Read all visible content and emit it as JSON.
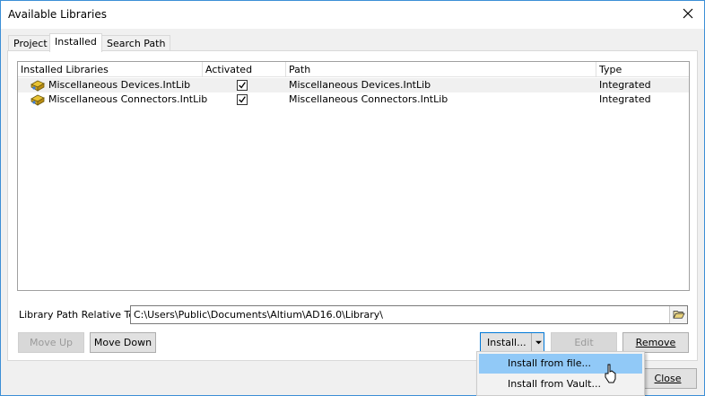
{
  "window": {
    "title": "Available Libraries"
  },
  "tabs": [
    {
      "label": "Project"
    },
    {
      "label": "Installed"
    },
    {
      "label": "Search Path"
    }
  ],
  "grid": {
    "columns": [
      "Installed Libraries",
      "Activated",
      "Path",
      "Type"
    ],
    "rows": [
      {
        "name": "Miscellaneous Devices.IntLib",
        "activated": true,
        "path": "Miscellaneous Devices.IntLib",
        "type": "Integrated"
      },
      {
        "name": "Miscellaneous Connectors.IntLib",
        "activated": true,
        "path": "Miscellaneous Connectors.IntLib",
        "type": "Integrated"
      }
    ]
  },
  "path_field": {
    "label": "Library Path Relative To:",
    "value": "C:\\Users\\Public\\Documents\\Altium\\AD16.0\\Library\\"
  },
  "buttons": {
    "move_up": "Move Up",
    "move_down": "Move Down",
    "install": "Install...",
    "edit": "Edit",
    "remove": "Remove",
    "close": "Close"
  },
  "install_menu": {
    "items": [
      "Install from file...",
      "Install from Vault..."
    ]
  },
  "icons": {
    "library": "library-book-icon",
    "close": "close-icon",
    "browse": "folder-open-icon",
    "dropdown": "dropdown-arrow-icon",
    "cursor": "mouse-pointer-icon"
  }
}
